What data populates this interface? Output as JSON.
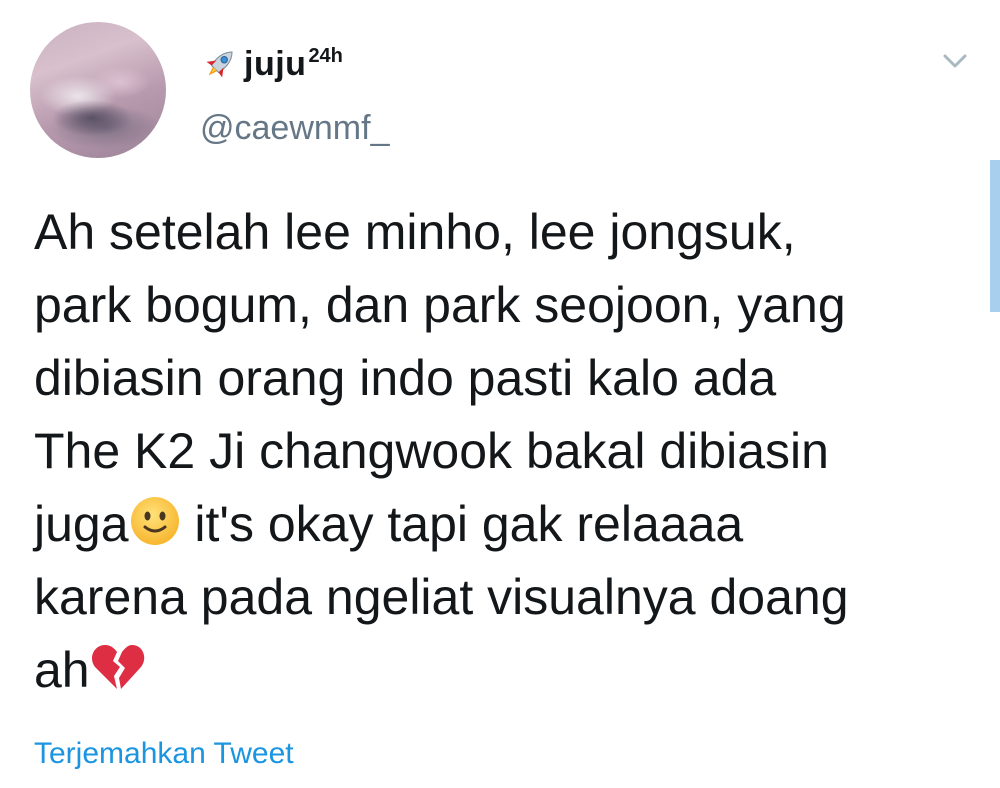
{
  "user": {
    "display_name": "juju",
    "display_name_superscript": "24h",
    "handle": "@caewnmf_",
    "name_prefix_icon": "rocket-icon",
    "avatar_icon": "pink-cloud-sky-avatar"
  },
  "tweet": {
    "lines": [
      "Ah setelah lee minho, lee jongsuk,",
      "park bogum, dan park seojoon, yang",
      "dibiasin orang indo pasti kalo ada",
      "The K2 Ji changwook bakal dibiasin",
      {
        "before": "juga",
        "emoji": "slightly-smiling-face-icon",
        "after": " it's okay tapi gak relaaaa"
      },
      "karena pada ngeliat visualnya doang",
      {
        "before": "ah",
        "emoji": "broken-heart-icon",
        "after": ""
      }
    ],
    "line_1": "Ah setelah lee minho, lee jongsuk,",
    "line_2": "park bogum, dan park seojoon, yang",
    "line_3": "dibiasin orang indo pasti kalo ada",
    "line_4": "The K2 Ji changwook bakal dibiasin",
    "line_5_before": "juga",
    "line_5_after": " it's okay tapi gak relaaaa",
    "line_6": "karena pada ngeliat visualnya doang",
    "line_7_before": "ah"
  },
  "actions": {
    "translate_label": "Terjemahkan Tweet",
    "menu_icon": "chevron-down-icon"
  },
  "colors": {
    "text": "#14171a",
    "secondary_text": "#657786",
    "link": "#1b95e0",
    "chevron": "#aab8c2",
    "scroll_indicator": "#a8cfee"
  }
}
